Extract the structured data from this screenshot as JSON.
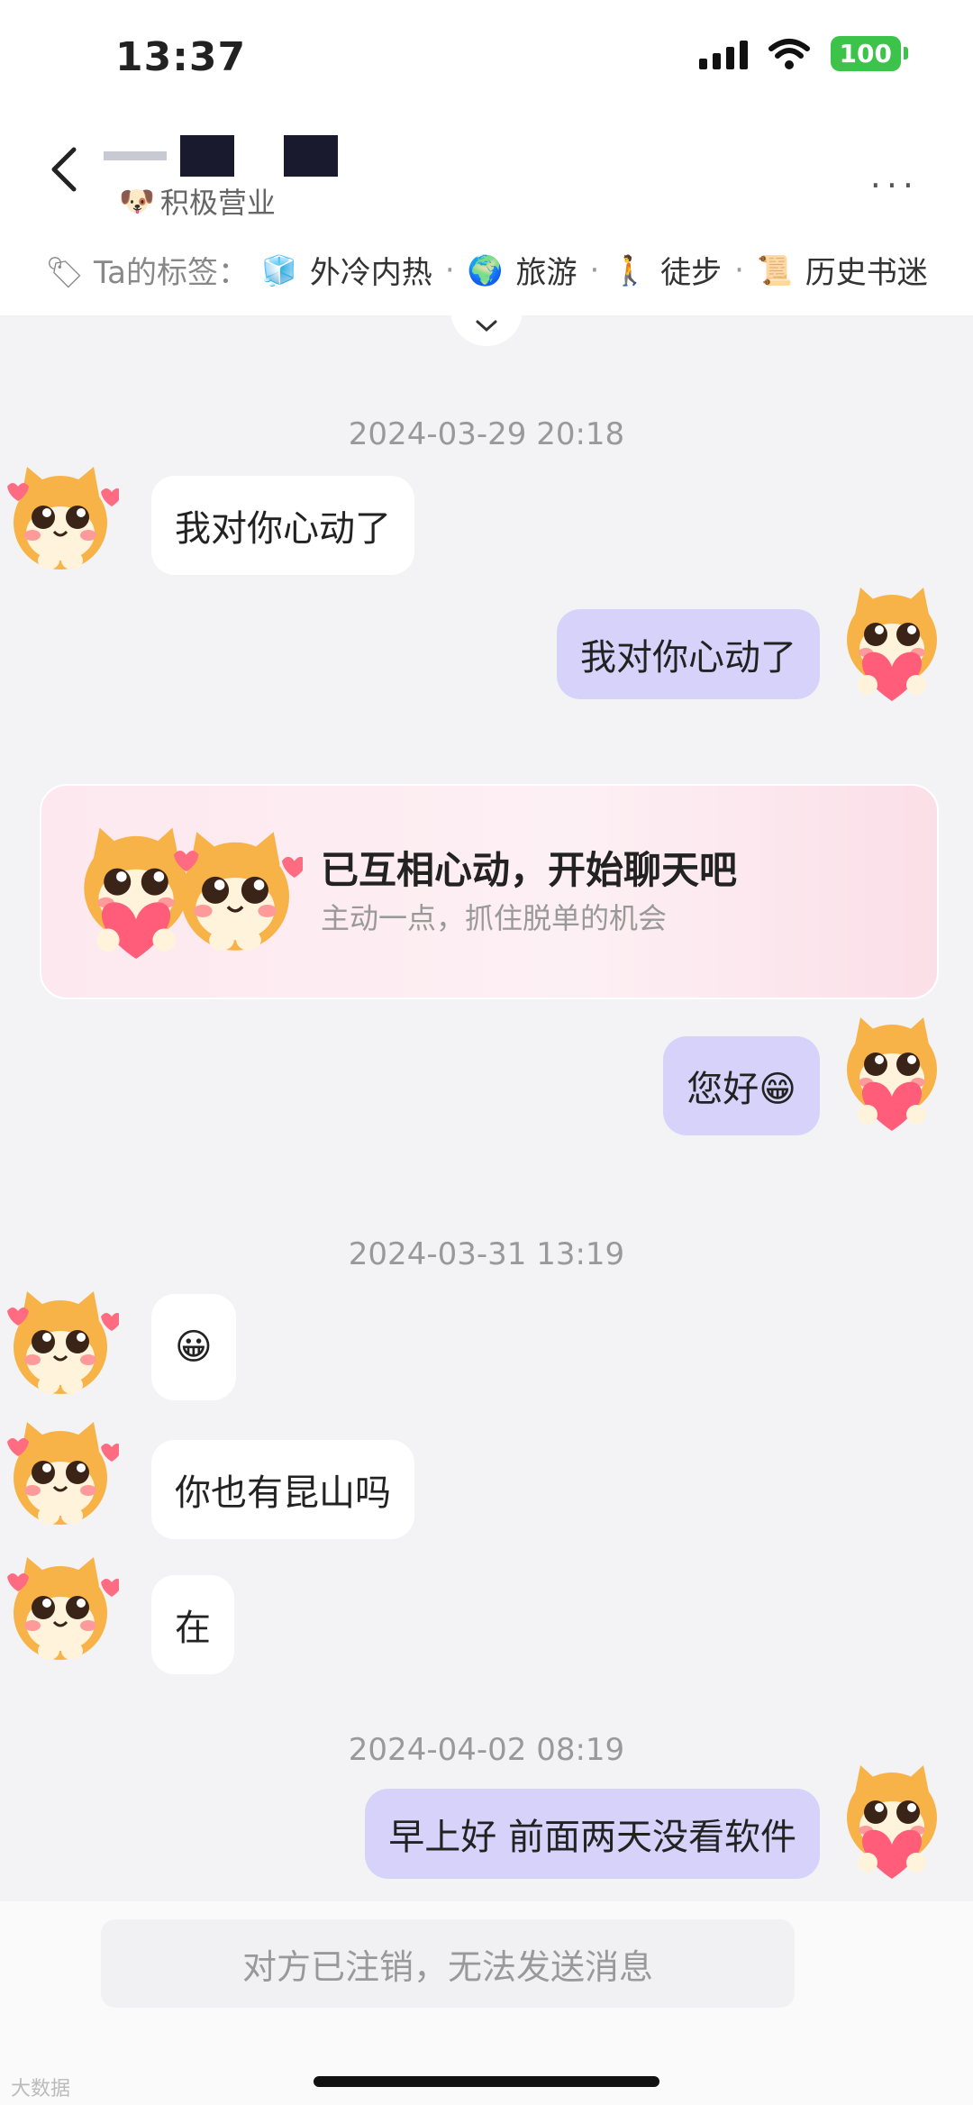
{
  "status_bar": {
    "time": "13:37",
    "battery": "100"
  },
  "header": {
    "status": "积极营业",
    "more": "···"
  },
  "tags": {
    "lead": "Ta的标签：",
    "items": [
      {
        "icon": "🧊",
        "label": "外冷内热"
      },
      {
        "icon": "🌍",
        "label": "旅游"
      },
      {
        "icon": "🚶",
        "label": "徒步"
      },
      {
        "icon": "📜",
        "label": "历史书迷"
      }
    ]
  },
  "messages": {
    "t1": "2024-03-29 20:18",
    "m1": "我对你心动了",
    "m2": "我对你心动了",
    "card_title": "已互相心动，开始聊天吧",
    "card_sub": "主动一点，抓住脱单的机会",
    "m3": "您好😁",
    "t2": "2024-03-31 13:19",
    "m4": "😀",
    "m5": "你也有昆山吗",
    "m6": "在",
    "t3": "2024-04-02 08:19",
    "m7": "早上好  前面两天没看软件"
  },
  "input": {
    "disabled_text": "对方已注销，无法发送消息"
  },
  "watermark": "大数据"
}
